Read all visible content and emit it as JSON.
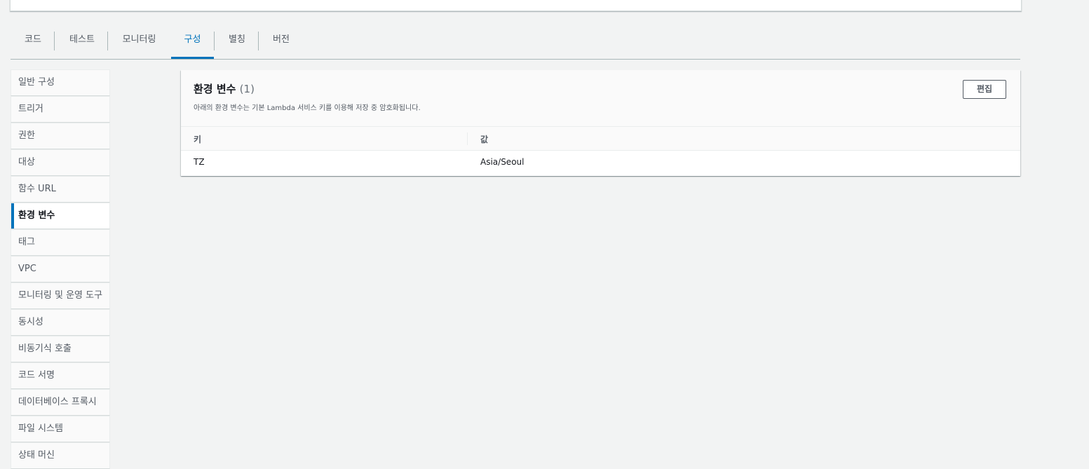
{
  "tabs": [
    {
      "label": "코드",
      "active": false
    },
    {
      "label": "테스트",
      "active": false
    },
    {
      "label": "모니터링",
      "active": false
    },
    {
      "label": "구성",
      "active": true
    },
    {
      "label": "별칭",
      "active": false
    },
    {
      "label": "버전",
      "active": false
    }
  ],
  "sidebar": {
    "items": [
      {
        "label": "일반 구성"
      },
      {
        "label": "트리거"
      },
      {
        "label": "권한"
      },
      {
        "label": "대상"
      },
      {
        "label": "함수 URL"
      },
      {
        "label": "환경 변수",
        "active": true
      },
      {
        "label": "태그"
      },
      {
        "label": "VPC"
      },
      {
        "label": "모니터링 및 운영 도구"
      },
      {
        "label": "동시성"
      },
      {
        "label": "비동기식 호출"
      },
      {
        "label": "코드 서명"
      },
      {
        "label": "데이터베이스 프록시"
      },
      {
        "label": "파일 시스템"
      },
      {
        "label": "상태 머신"
      }
    ]
  },
  "env": {
    "title": "환경 변수",
    "count": "(1)",
    "description": "아래의 환경 변수는 기본 Lambda 서비스 키를 이용해 저장 중 암호화됩니다.",
    "edit_label": "편집",
    "columns": {
      "key": "키",
      "value": "값"
    },
    "rows": [
      {
        "key": "TZ",
        "value": "Asia/Seoul"
      }
    ]
  },
  "colors": {
    "accent": "#0073bb",
    "background": "#f2f3f3"
  }
}
